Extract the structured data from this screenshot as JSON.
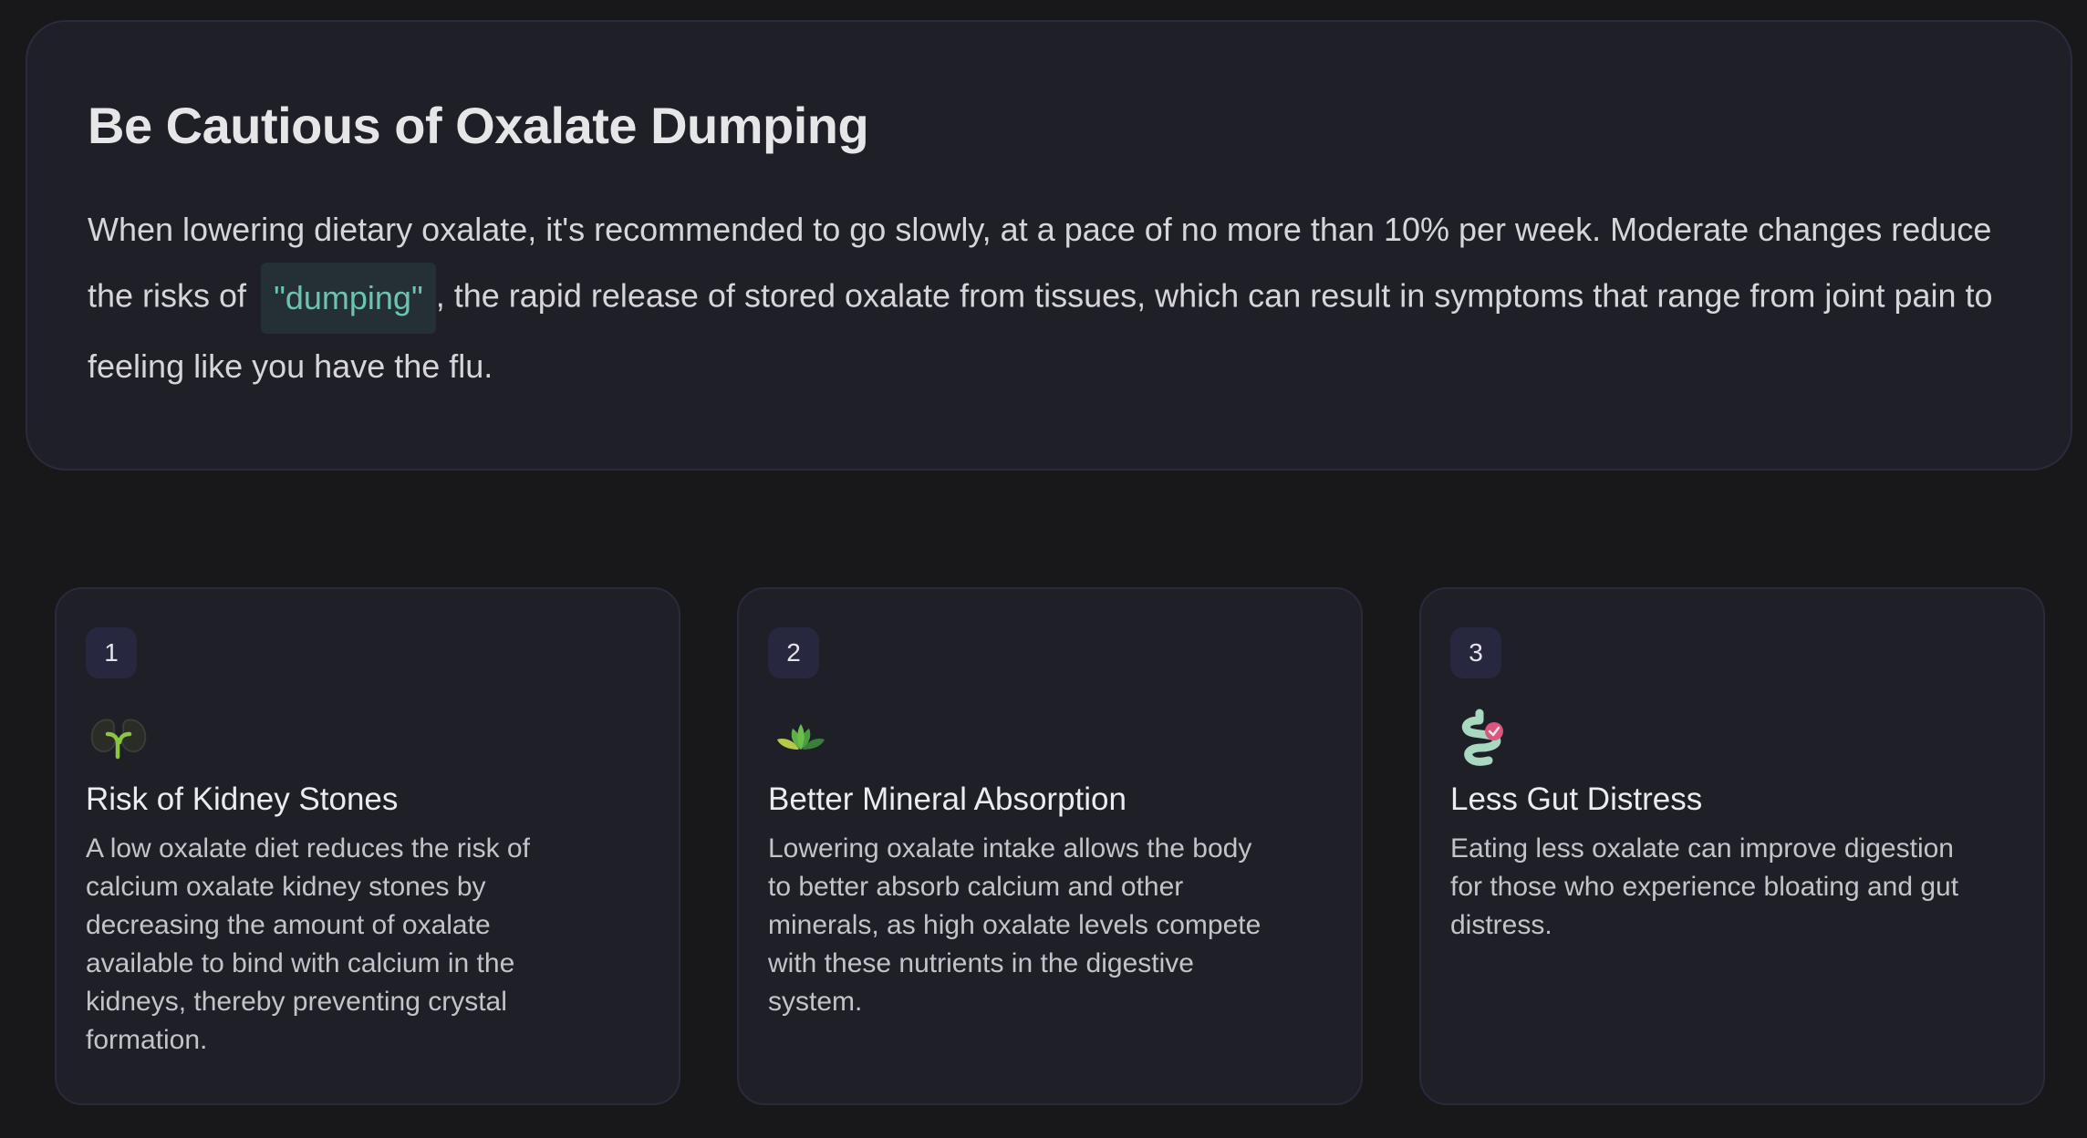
{
  "hero": {
    "title": "Be Cautious of Oxalate Dumping",
    "text_before": "When lowering dietary oxalate, it's recommended to go slowly, at a pace of no more than 10% per week. Moderate changes reduce the risks of",
    "highlight": "\"dumping\"",
    "text_after": ", the rapid release of stored oxalate from tissues, which can result in symptoms that range from joint pain to feeling like you have the flu."
  },
  "cards": [
    {
      "number": "1",
      "icon": "kidney-icon",
      "title": "Risk of Kidney Stones",
      "text": "A low oxalate diet reduces the risk of calcium oxalate kidney stones by decreasing the amount of oxalate available to bind with calcium in the kidneys, thereby preventing crystal formation."
    },
    {
      "number": "2",
      "icon": "lotus-icon",
      "title": "Better Mineral Absorption",
      "text": "Lowering oxalate intake allows the body to better absorb calcium and other minerals, as high oxalate levels compete with these nutrients in the digestive system."
    },
    {
      "number": "3",
      "icon": "intestine-icon",
      "title": "Less Gut Distress",
      "text": "Eating less oxalate can improve digestion for those who experience bloating and gut distress."
    }
  ],
  "colors": {
    "background": "#18181b",
    "panel": "#1e1f27",
    "highlight_text": "#6cc3b1",
    "highlight_bg": "#243034",
    "badge_bg": "#272740"
  }
}
